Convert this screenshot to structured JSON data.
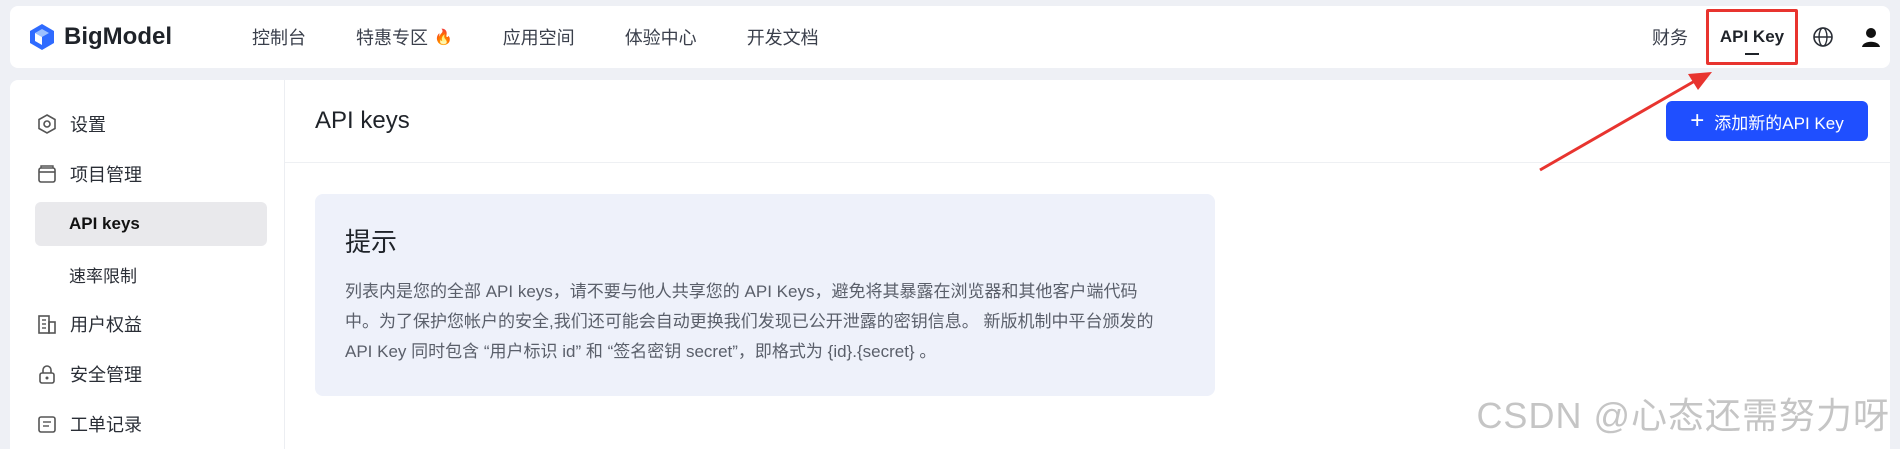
{
  "brand": {
    "name": "BigModel"
  },
  "nav": {
    "items": [
      {
        "label": "控制台"
      },
      {
        "label": "特惠专区",
        "badge": "🔥"
      },
      {
        "label": "应用空间"
      },
      {
        "label": "体验中心"
      },
      {
        "label": "开发文档"
      }
    ],
    "right": {
      "finance": "财务",
      "api_key": "API Key"
    }
  },
  "sidebar": {
    "settings": "设置",
    "project_mgmt": "项目管理",
    "api_keys": "API keys",
    "rate_limit": "速率限制",
    "user_rights": "用户权益",
    "security": "安全管理",
    "tickets": "工单记录"
  },
  "main": {
    "title": "API keys",
    "add_button": "添加新的API Key",
    "notice": {
      "title": "提示",
      "line1": "列表内是您的全部 API keys，请不要与他人共享您的 API Keys，避免将其暴露在浏览器和其他客户端代码",
      "line2": "中。为了保护您帐户的安全,我们还可能会自动更换我们发现已公开泄露的密钥信息。 新版机制中平台颁发的",
      "line3": "API Key 同时包含 “用户标识 id” 和 “签名密钥 secret”，即格式为 {id}.{secret} 。"
    }
  },
  "watermark": "CSDN @心态还需努力呀",
  "colors": {
    "primary": "#1f4fff",
    "highlight": "#e8342f"
  }
}
